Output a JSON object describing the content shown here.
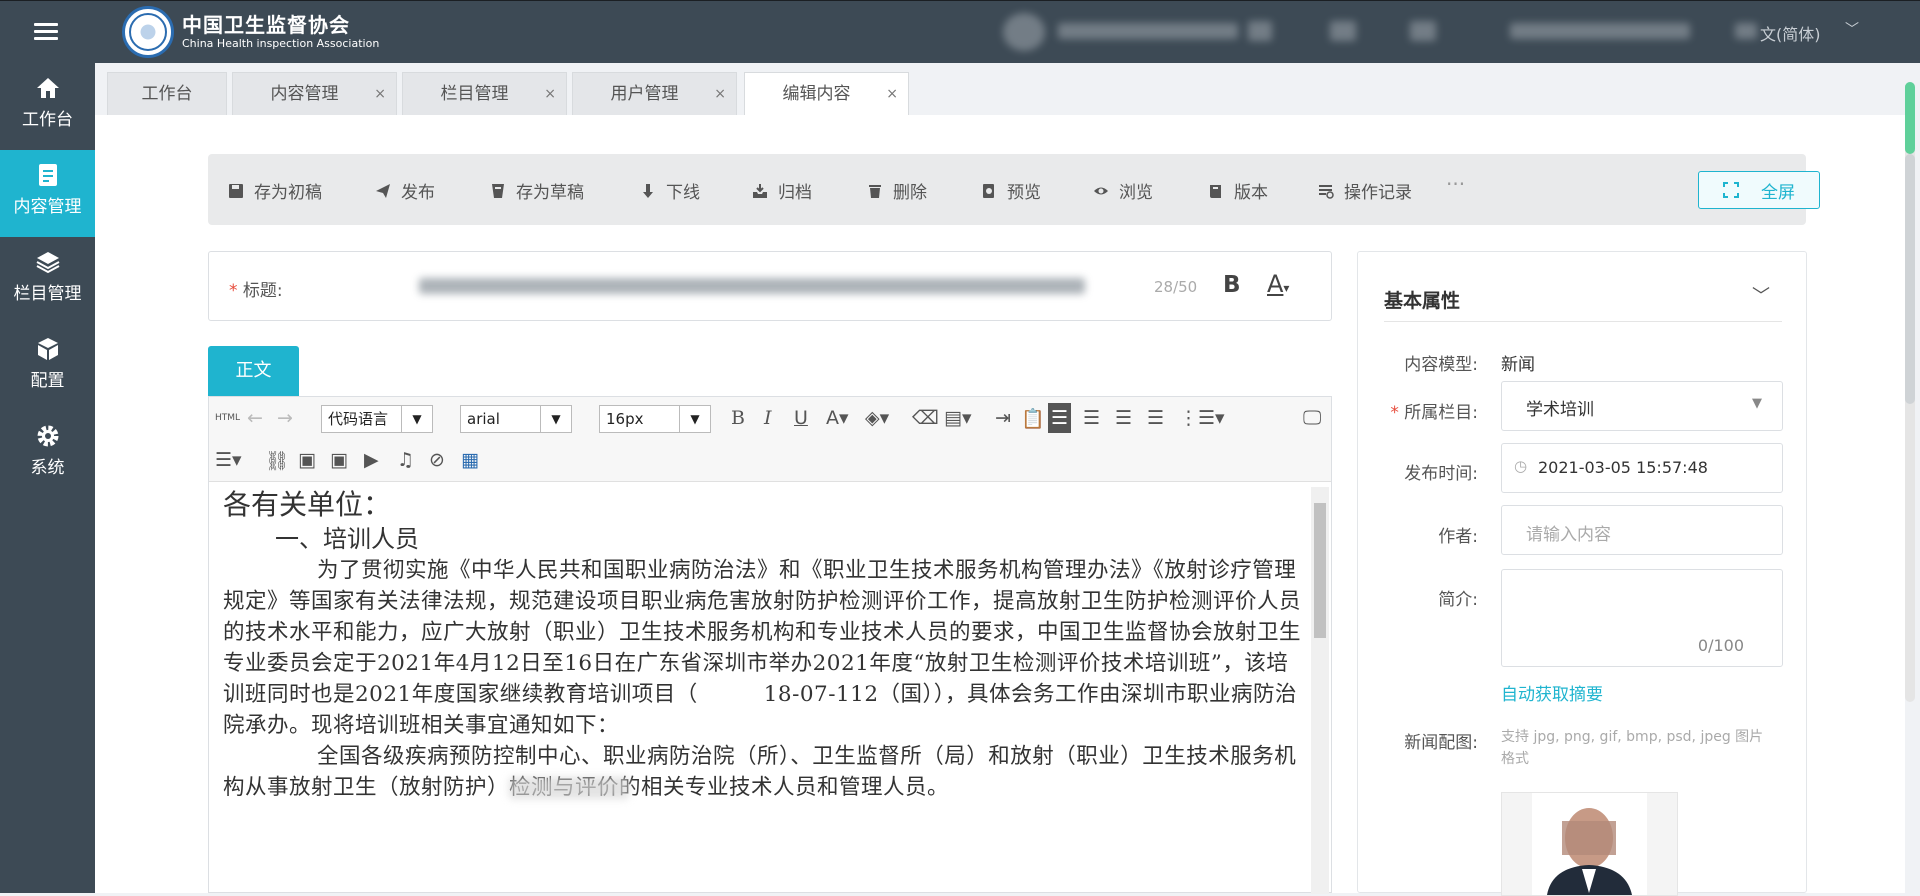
{
  "header": {
    "logo_cn": "中国卫生监督协会",
    "logo_en": "China Health inspection Association",
    "language": "文(简体)"
  },
  "sidebar": {
    "items": [
      {
        "label": "工作台",
        "icon": "home-icon"
      },
      {
        "label": "内容管理",
        "icon": "document-edit-icon",
        "active": true
      },
      {
        "label": "栏目管理",
        "icon": "layers-icon"
      },
      {
        "label": "配置",
        "icon": "cube-icon"
      },
      {
        "label": "系统",
        "icon": "gear-icon"
      }
    ]
  },
  "tabs": [
    {
      "label": "工作台"
    },
    {
      "label": "内容管理",
      "close": "×"
    },
    {
      "label": "栏目管理",
      "close": "×"
    },
    {
      "label": "用户管理",
      "close": "×"
    },
    {
      "label": "编辑内容",
      "close": "×",
      "active": true
    }
  ],
  "toolbar": {
    "save_draft_initial": "存为初稿",
    "publish": "发布",
    "save_draft": "存为草稿",
    "offline": "下线",
    "archive": "归档",
    "delete": "删除",
    "preview": "预览",
    "browse": "浏览",
    "version": "版本",
    "operation_log": "操作记录",
    "more": "···",
    "fullscreen": "全屏"
  },
  "title_field": {
    "required_mark": "*",
    "label": "标题:",
    "count": "28/50",
    "bold": "B",
    "color": "A"
  },
  "body_tab": "正文",
  "editor": {
    "html_label": "HTML",
    "code_language": "代码语言",
    "font_family": "arial",
    "font_size": "16px",
    "content": {
      "salutation": "各有关单位：",
      "section1": "一、培训人员",
      "para1": "为了贯彻实施《中华人民共和国职业病防治法》和《职业卫生技术服务机构管理办法》《放射诊疗管理规定》等国家有关法律法规，规范建设项目职业病危害放射防护检测评价工作，提高放射卫生防护检测评价人员的技术水平和能力，应广大放射（职业）卫生技术服务机构和专业技术人员的要求，中国卫生监督协会放射卫生专业委员会定于2021年4月12日至16日在广东省深圳市举办2021年度“放射卫生检测评价技术培训班”，该培训班同时也是2021年度国家继续教育培训项目（　　　18-07-112（国）），具体会务工作由深圳市职业病防治院承办。现将培训班相关事宜通知如下：",
      "para2": "全国各级疾病预防控制中心、职业病防治院（所）、卫生监督所（局）和放射（职业）卫生技术服务机构从事放射卫生（放射防护）检测与评价的相关专业技术人员和管理人员。"
    }
  },
  "properties": {
    "title": "基本属性",
    "content_model_label": "内容模型:",
    "content_model_value": "新闻",
    "column_label": "所属栏目:",
    "column_value": "学术培训",
    "publish_time_label": "发布时间:",
    "publish_time_value": "2021-03-05 15:57:48",
    "author_label": "作者:",
    "author_placeholder": "请输入内容",
    "summary_label": "简介:",
    "summary_count": "0/100",
    "auto_summary": "自动获取摘要",
    "image_label": "新闻配图:",
    "image_hint": "支持 jpg, png, gif, bmp, psd, jpeg 图片格式"
  },
  "colors": {
    "accent": "#1fb4cf",
    "sidebar_bg": "#3d4a55",
    "required": "#e74c3c"
  }
}
